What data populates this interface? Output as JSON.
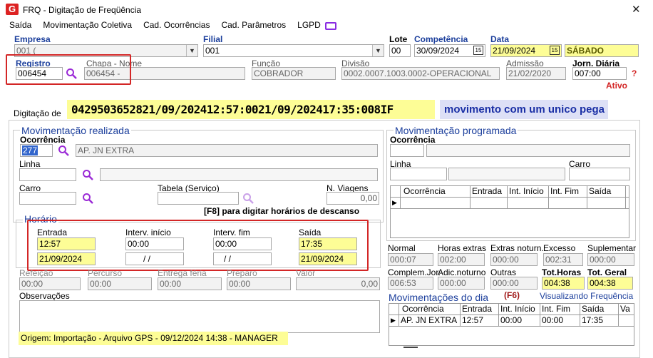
{
  "window": {
    "title": "FRQ - Digitação de Freqüência",
    "close": "✕"
  },
  "menu": [
    "Saída",
    "Movimentação Coletiva",
    "Cad. Ocorrências",
    "Cad. Parâmetros",
    "LGPD"
  ],
  "empresa": {
    "label": "Empresa",
    "value": "001 ("
  },
  "filial": {
    "label": "Filial",
    "value": "001"
  },
  "lote": {
    "label": "Lote",
    "value": "00"
  },
  "competencia": {
    "label": "Competência",
    "value": "30/09/2024"
  },
  "data": {
    "label": "Data",
    "value": "21/09/2024",
    "weekday": "SÁBADO"
  },
  "registro": {
    "label": "Registro",
    "value": "006454"
  },
  "chapa": {
    "label": "Chapa  -  Nome",
    "value": "006454 -"
  },
  "funcao": {
    "label": "Função",
    "value": "COBRADOR"
  },
  "divisao": {
    "label": "Divisão",
    "value": "0002.0007.1003.0002-OPERACIONAL"
  },
  "admissao": {
    "label": "Admissão",
    "value": "21/02/2020"
  },
  "jornada": {
    "label": "Jorn. Diária",
    "value": "007:00",
    "help": "?",
    "status": "Ativo"
  },
  "digitacao_tab": "Digitação de",
  "banner": {
    "code": "0429503652821/09/202412:57:0021/09/202417:35:008IF",
    "note": "movimento com um unico pega"
  },
  "realizada": {
    "title": "Movimentação realizada",
    "ocorrencia_label": "Ocorrência",
    "ocorrencia_code": "277",
    "ocorrencia_desc": "AP. JN EXTRA",
    "linha_label": "Linha",
    "carro_label": "Carro",
    "tabela_label": "Tabela (Serviço)",
    "nviagens_label": "N. Viagens",
    "nviagens_value": "0,00",
    "f8_hint": "[F8] para digitar horários de descanso"
  },
  "horario": {
    "title": "Horário",
    "entrada_label": "Entrada",
    "entrada_time": "12:57",
    "entrada_date": "21/09/2024",
    "interv_inicio_label": "Interv. início",
    "interv_inicio_time": "00:00",
    "interv_inicio_date": "/ /",
    "interv_fim_label": "Interv. fim",
    "interv_fim_time": "00:00",
    "interv_fim_date": "/ /",
    "saida_label": "Saída",
    "saida_time": "17:35",
    "saida_date": "21/09/2024"
  },
  "extras": {
    "refeicao_label": "Refeição",
    "refeicao_value": "00:00",
    "percurso_label": "Percurso",
    "percurso_value": "00:00",
    "entrega_label": "Entrega féria",
    "entrega_value": "00:00",
    "preparo_label": "Preparo",
    "preparo_value": "00:00",
    "valor_label": "Valor",
    "valor_value": "0,00"
  },
  "observacoes_label": "Observações",
  "origem": "Origem: Importação - Arquivo GPS - 09/12/2024 14:38 - MANAGER",
  "programada": {
    "title": "Movimentação programada",
    "ocorrencia_label": "Ocorrência",
    "linha_label": "Linha",
    "carro_label": "Carro",
    "columns": [
      "Ocorrência",
      "Entrada",
      "Int. Início",
      "Int. Fim",
      "Saída"
    ]
  },
  "totais": {
    "normal_label": "Normal",
    "normal_value": "000:07",
    "horas_extras_label": "Horas extras",
    "horas_extras_value": "002:00",
    "extras_noturn_label": "Extras noturn.",
    "extras_noturn_value": "000:00",
    "excesso_label": "Excesso",
    "excesso_value": "002:31",
    "suplementar_label": "Suplementar",
    "suplementar_value": "000:00",
    "complem_label": "Complem.Jor.",
    "complem_value": "006:53",
    "adic_noturno_label": "Adic.noturno",
    "adic_noturno_value": "000:00",
    "outras_label": "Outras",
    "outras_value": "000:00",
    "tot_horas_label": "Tot.Horas",
    "tot_horas_value": "004:38",
    "tot_geral_label": "Tot. Geral",
    "tot_geral_value": "004:38"
  },
  "dia": {
    "title": "Movimentações do dia",
    "shortcut": "(F6)",
    "link": "Visualizando Frequência",
    "columns": [
      "Ocorrência",
      "Entrada",
      "Int. Início",
      "Int. Fim",
      "Saída",
      "Va"
    ],
    "rows": [
      [
        "AP. JN EXTRA",
        "12:57",
        "00:00",
        "00:00",
        "17:35",
        ""
      ]
    ]
  },
  "colors": {
    "accent_blue": "#1c3f9c",
    "highlight_yellow": "#fdfd96",
    "red_box": "#d32626",
    "logo_red": "#d22"
  }
}
